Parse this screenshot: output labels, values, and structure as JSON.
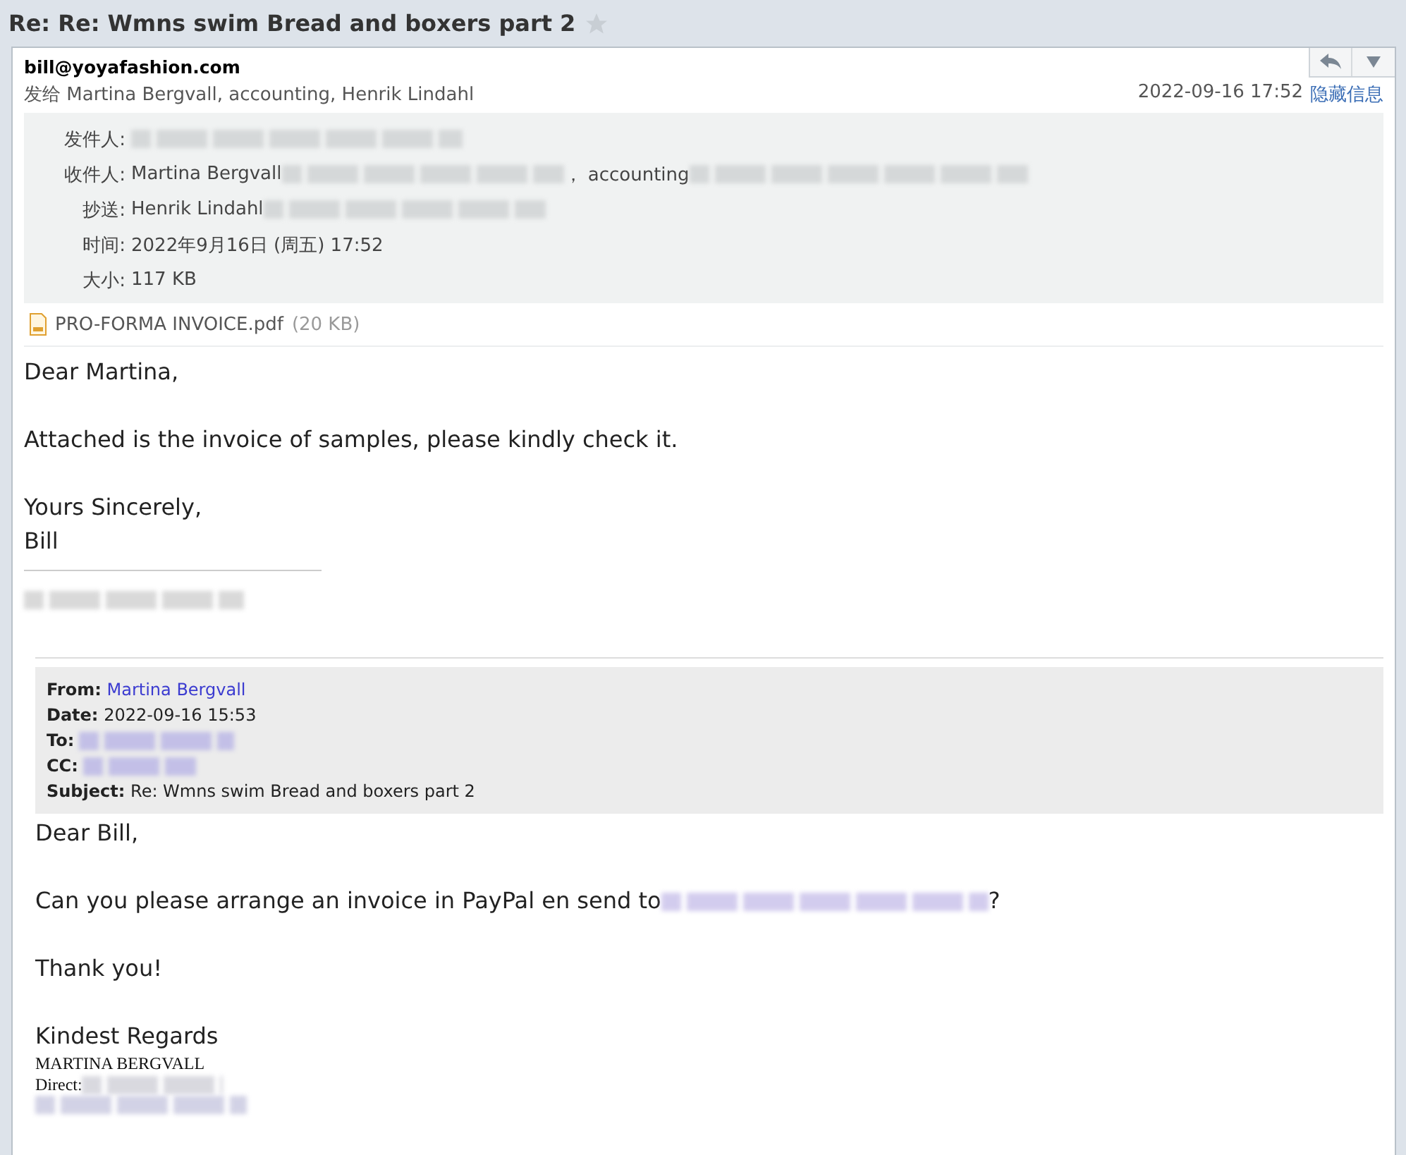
{
  "subject": "Re: Re: Wmns swim Bread and boxers part 2",
  "starred": false,
  "sender": "bill@yoyafashion.com",
  "recipients_line": "发给 Martina Bergvall, accounting, Henrik Lindahl",
  "date": "2022-09-16 17:52",
  "hide_details_link": "隐藏信息",
  "details": [
    {
      "label": "发件人:"
    },
    {
      "label": "收件人:",
      "value": "Martina Bergvall",
      "extra": "， accounting"
    },
    {
      "label": "抄送:",
      "value": "Henrik Lindahl"
    },
    {
      "label": "时间:",
      "value": "2022年9月16日 (周五) 17:52"
    },
    {
      "label": "大小:",
      "value": "117 KB"
    }
  ],
  "attachment": {
    "name": "PRO-FORMA INVOICE.pdf",
    "size": "(20 KB)"
  },
  "body": [
    [
      "Dear Martina,"
    ],
    [
      "Attached is the invoice of samples, please kindly check it."
    ],
    [
      "Yours Sincerely,",
      "Bill"
    ]
  ],
  "quoted": {
    "fields": [
      {
        "label": "From:",
        "value": "Martina Bergvall",
        "link": true
      },
      {
        "label": "Date:",
        "value": "2022-09-16 15:53",
        "link": false
      },
      {
        "label": "To:",
        "link": true
      },
      {
        "label": "CC:",
        "link": true
      },
      {
        "label": "Subject:",
        "value": "Re: Wmns swim Bread and boxers part 2",
        "link": false
      }
    ],
    "body": [
      [
        "Dear Bill,"
      ],
      [
        "Can you please arrange an invoice in PayPal en send to"
      ],
      [
        "Thank you!"
      ],
      [
        "Kindest Regards"
      ]
    ],
    "end_mark": "?",
    "signature": [
      "MARTINA BERGVALL",
      "Direct:"
    ]
  }
}
